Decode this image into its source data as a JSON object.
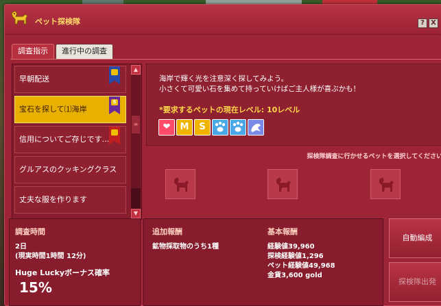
{
  "window": {
    "title": "ペット探検隊"
  },
  "titlebar": {
    "help_label": "?",
    "close_label": "X"
  },
  "tabs": [
    {
      "label": "調査指示",
      "active": true
    },
    {
      "label": "進行中の調査",
      "active": false
    }
  ],
  "quest_list": [
    {
      "label": "早朝配送",
      "ribbon": "blue"
    },
    {
      "label": "宝石を探して⑴海岸",
      "ribbon": "purple",
      "selected": true
    },
    {
      "label": "信用についてご存じです...",
      "ribbon": "red"
    },
    {
      "label": "グルアスのクッキングクラス"
    },
    {
      "label": "丈夫な服を作ります"
    }
  ],
  "scrollbar": {
    "up": "▲",
    "down": "▼",
    "thumb": "≡"
  },
  "detail": {
    "description_line1": "海岸で輝く光を注意深く探してみよう。",
    "description_line2": "小さくて可愛い石を集めて持っていけばご主人様が喜ぶかも！",
    "required_level": "*要求するペットの現在レベル: 10レベル",
    "badges": [
      {
        "icon": "heart-icon",
        "text": "❤"
      },
      {
        "icon": "size-m-icon",
        "text": "M"
      },
      {
        "icon": "size-s-icon",
        "text": "S"
      },
      {
        "icon": "paw-icon",
        "text": ""
      },
      {
        "icon": "paw-icon",
        "text": ""
      },
      {
        "icon": "seal-icon",
        "text": ""
      }
    ]
  },
  "pet_select": {
    "hint": "探検隊調査に行かせるペットを選択してください"
  },
  "time_panel": {
    "heading": "調査時間",
    "duration": "2日",
    "real_time": "(現実時間1時間 12分)",
    "bonus_label": "Huge Luckyボーナス確率",
    "bonus_value": "15%"
  },
  "extra_reward": {
    "heading": "追加報酬",
    "item": "鉱物採取物のうち1種"
  },
  "base_reward": {
    "heading": "基本報酬",
    "lines": [
      "経験値39,960",
      "探検経験値1,296",
      "ペット経験値49,968",
      "金貨3,600 gold"
    ]
  },
  "buttons": {
    "auto_form": "自動編成",
    "depart": "探検隊出発"
  },
  "colors": {
    "window": "#9c2436",
    "selected": "#e8b000",
    "accent_text": "#ffd84a"
  }
}
